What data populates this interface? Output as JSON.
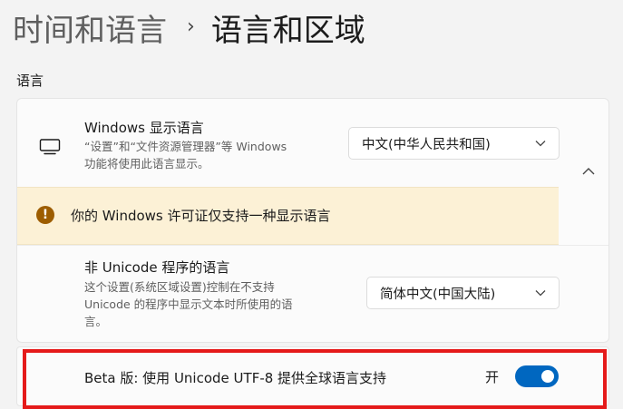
{
  "breadcrumb": {
    "parent": "时间和语言",
    "separator": "›",
    "current": "语言和区域"
  },
  "section": {
    "title": "语言"
  },
  "display_language": {
    "title": "Windows 显示语言",
    "description_line1": "“设置”和“文件资源管理器”等 Windows",
    "description_line2": "功能将使用此语言显示。",
    "selected": "中文(中华人民共和国)",
    "icon": "monitor-icon"
  },
  "warning": {
    "text": "你的 Windows 许可证仅支持一种显示语言",
    "icon": "!"
  },
  "non_unicode": {
    "title": "非 Unicode 程序的语言",
    "description_line1": "这个设置(系统区域设置)控制在不支持",
    "description_line2": "Unicode 的程序中显示文本时所使用的语",
    "description_line3": "言。",
    "selected": "简体中文(中国大陆)"
  },
  "beta_utf8": {
    "label": "Beta 版: 使用 Unicode UTF-8 提供全球语言支持",
    "state": "开",
    "enabled": true
  },
  "colors": {
    "accent": "#0067c0",
    "warning_bg": "#fcf1d6",
    "warning_icon": "#9d5d00",
    "highlight": "#e51a1a"
  }
}
